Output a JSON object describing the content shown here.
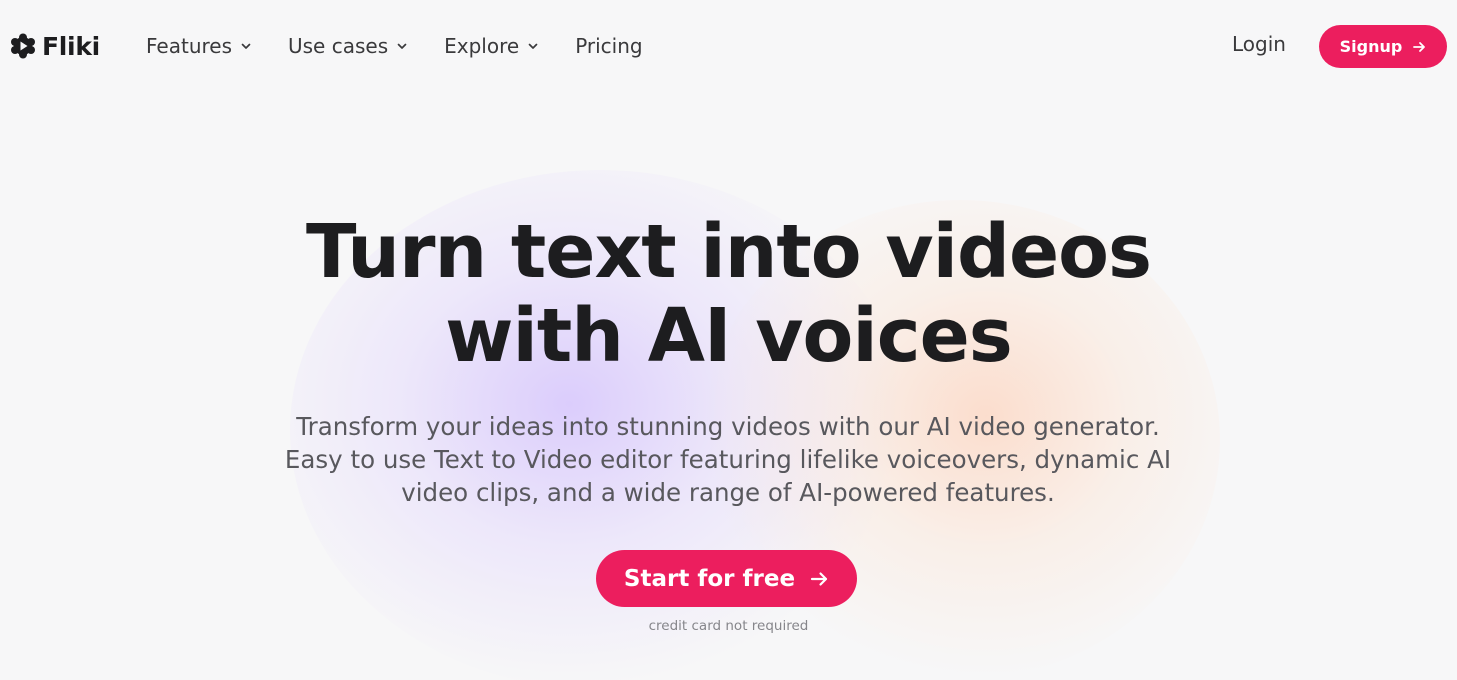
{
  "brand": {
    "name": "Fliki",
    "accent_color": "#ec1e5e",
    "logo_icon": "flower-play-icon"
  },
  "nav": {
    "items": [
      {
        "label": "Features",
        "has_dropdown": true
      },
      {
        "label": "Use cases",
        "has_dropdown": true
      },
      {
        "label": "Explore",
        "has_dropdown": true
      },
      {
        "label": "Pricing",
        "has_dropdown": false
      }
    ],
    "login_label": "Login",
    "signup_label": "Signup"
  },
  "hero": {
    "title_line1": "Turn text into videos",
    "title_line2": "with AI voices",
    "subtitle_line1": "Transform your ideas into stunning videos with our AI video generator.",
    "subtitle_line2": "Easy to use Text to Video editor featuring lifelike voiceovers, dynamic AI",
    "subtitle_line3": "video clips, and a wide range of AI-powered features.",
    "cta_label": "Start for free",
    "cta_note": "credit card not required"
  }
}
